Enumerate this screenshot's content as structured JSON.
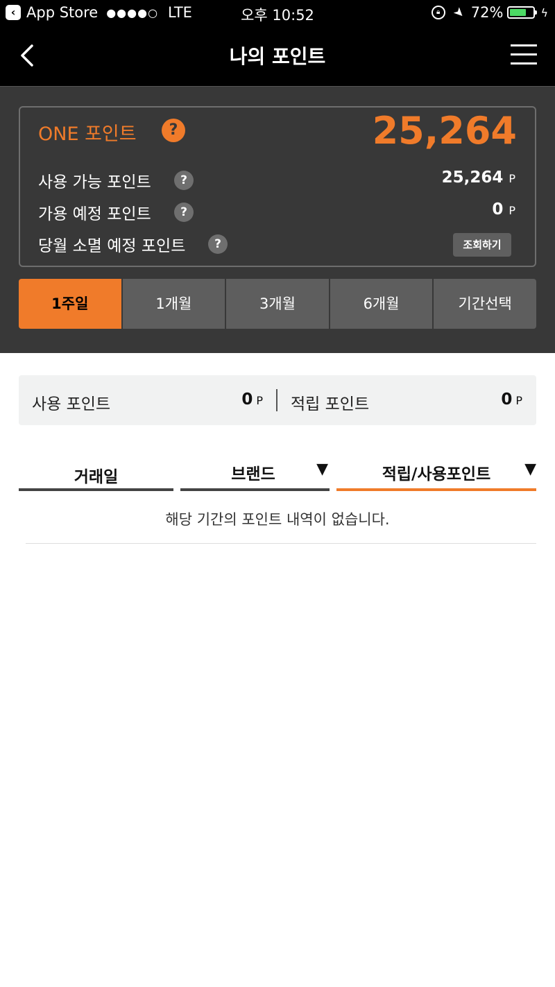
{
  "status_bar": {
    "app_back": "App Store",
    "signal": "●●●●○",
    "carrier": "LTE",
    "time": "오후 10:52",
    "battery": "72%",
    "battery_level": 0.72
  },
  "nav": {
    "title": "나의 포인트"
  },
  "points": {
    "one_label": "ONE 포인트",
    "one_value": "25,264",
    "help": "?",
    "rows": [
      {
        "label": "사용 가능 포인트",
        "value": "25,264",
        "unit": "P"
      },
      {
        "label": "가용 예정 포인트",
        "value": "0",
        "unit": "P"
      },
      {
        "label": "당월 소멸 예정 포인트",
        "button": "조회하기"
      }
    ]
  },
  "period_tabs": [
    {
      "label": "1주일",
      "active": true
    },
    {
      "label": "1개월",
      "active": false
    },
    {
      "label": "3개월",
      "active": false
    },
    {
      "label": "6개월",
      "active": false
    },
    {
      "label": "기간선택",
      "active": false
    }
  ],
  "summary": {
    "used_label": "사용 포인트",
    "used_value": "0",
    "earned_label": "적립 포인트",
    "earned_value": "0",
    "unit": "P"
  },
  "history": {
    "columns": [
      {
        "label": "거래일"
      },
      {
        "label": "브랜드",
        "arrow": "▼"
      },
      {
        "label": "적립/사용포인트",
        "arrow": "▼"
      }
    ],
    "empty_message": "해당 기간의  포인트 내역이 없습니다."
  },
  "colors": {
    "accent": "#f07b2a",
    "panel": "#383838",
    "tab": "#5e5e5e"
  }
}
